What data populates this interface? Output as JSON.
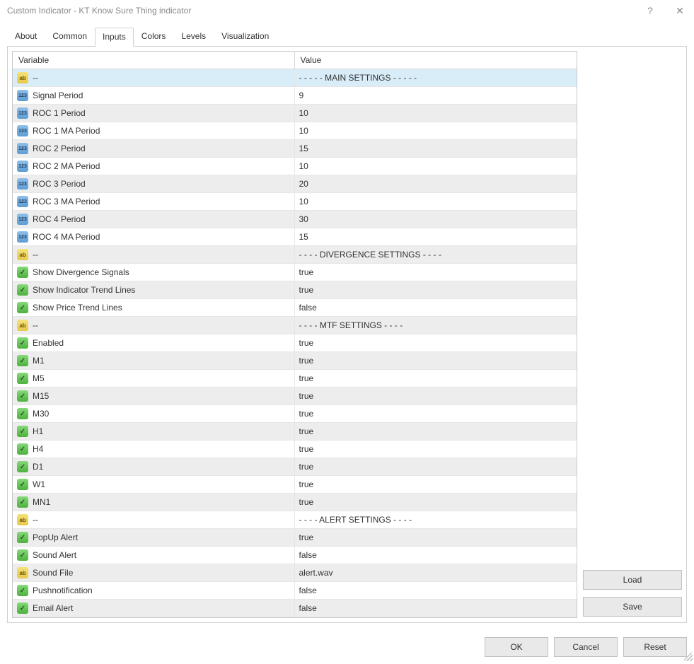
{
  "window": {
    "title": "Custom Indicator - KT Know Sure Thing indicator"
  },
  "tabs": [
    "About",
    "Common",
    "Inputs",
    "Colors",
    "Levels",
    "Visualization"
  ],
  "activeTab": 2,
  "columns": {
    "variable": "Variable",
    "value": "Value"
  },
  "rows": [
    {
      "icon": "str",
      "name": "--",
      "value": "- - - - - MAIN SETTINGS - - - - -",
      "selected": true
    },
    {
      "icon": "int",
      "name": "Signal Period",
      "value": "9"
    },
    {
      "icon": "int",
      "name": "ROC 1 Period",
      "value": "10"
    },
    {
      "icon": "int",
      "name": "ROC 1 MA Period",
      "value": "10"
    },
    {
      "icon": "int",
      "name": "ROC 2 Period",
      "value": "15"
    },
    {
      "icon": "int",
      "name": "ROC 2 MA Period",
      "value": "10"
    },
    {
      "icon": "int",
      "name": "ROC 3 Period",
      "value": "20"
    },
    {
      "icon": "int",
      "name": "ROC 3 MA Period",
      "value": "10"
    },
    {
      "icon": "int",
      "name": "ROC 4 Period",
      "value": "30"
    },
    {
      "icon": "int",
      "name": "ROC 4 MA Period",
      "value": "15"
    },
    {
      "icon": "str",
      "name": "--",
      "value": "- - - - DIVERGENCE SETTINGS - - - -"
    },
    {
      "icon": "bool",
      "name": "Show Divergence Signals",
      "value": "true"
    },
    {
      "icon": "bool",
      "name": "Show Indicator Trend Lines",
      "value": "true"
    },
    {
      "icon": "bool",
      "name": "Show Price Trend Lines",
      "value": "false"
    },
    {
      "icon": "str",
      "name": "--",
      "value": "- - - - MTF SETTINGS - - - -"
    },
    {
      "icon": "bool",
      "name": "Enabled",
      "value": "true"
    },
    {
      "icon": "bool",
      "name": "M1",
      "value": "true"
    },
    {
      "icon": "bool",
      "name": "M5",
      "value": "true"
    },
    {
      "icon": "bool",
      "name": "M15",
      "value": "true"
    },
    {
      "icon": "bool",
      "name": "M30",
      "value": "true"
    },
    {
      "icon": "bool",
      "name": "H1",
      "value": "true"
    },
    {
      "icon": "bool",
      "name": "H4",
      "value": "true"
    },
    {
      "icon": "bool",
      "name": "D1",
      "value": "true"
    },
    {
      "icon": "bool",
      "name": "W1",
      "value": "true"
    },
    {
      "icon": "bool",
      "name": "MN1",
      "value": "true"
    },
    {
      "icon": "str",
      "name": "--",
      "value": "- - - - ALERT SETTINGS - - - -"
    },
    {
      "icon": "bool",
      "name": "PopUp Alert",
      "value": "true"
    },
    {
      "icon": "bool",
      "name": "Sound Alert",
      "value": "false"
    },
    {
      "icon": "str",
      "name": "Sound File",
      "value": "alert.wav"
    },
    {
      "icon": "bool",
      "name": "Pushnotification",
      "value": "false"
    },
    {
      "icon": "bool",
      "name": "Email Alert",
      "value": "false"
    }
  ],
  "buttons": {
    "load": "Load",
    "save": "Save",
    "ok": "OK",
    "cancel": "Cancel",
    "reset": "Reset"
  }
}
